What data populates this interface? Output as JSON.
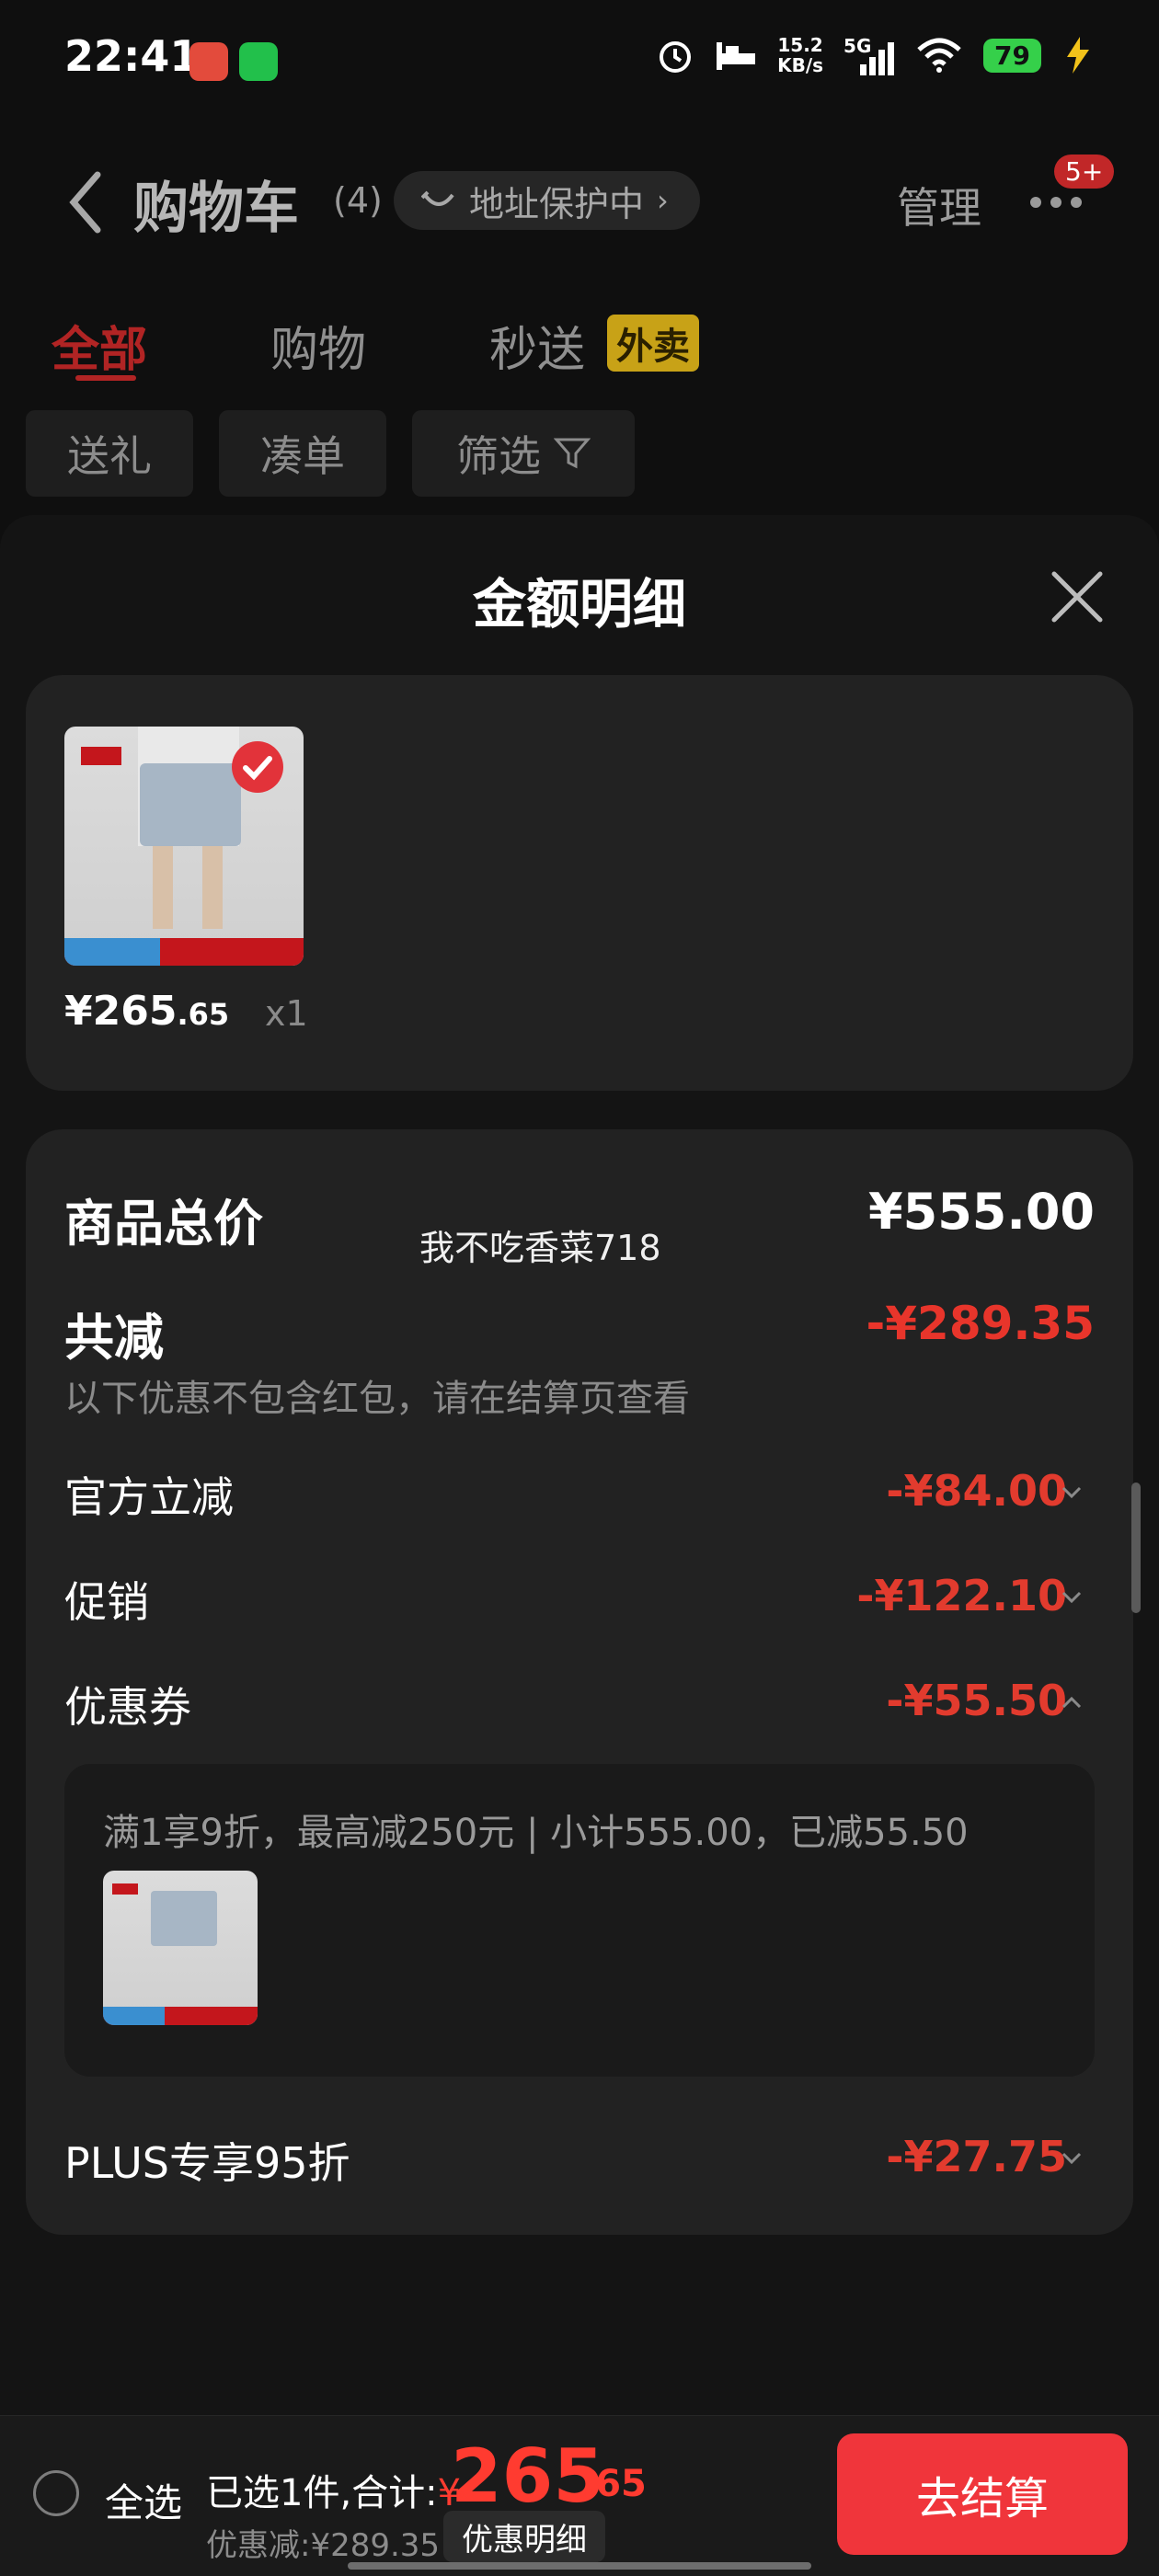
{
  "status_bar": {
    "time": "22:41",
    "net_speed_value": "15.2",
    "net_speed_unit": "KB/s",
    "network": "5G",
    "battery": "79",
    "icons": [
      "mall-app-icon",
      "wechat-icon",
      "alarm-icon",
      "sleep-icon",
      "signal-icon",
      "wifi-icon",
      "battery-icon",
      "charging-icon"
    ]
  },
  "header": {
    "title": "购物车",
    "count": "(4)",
    "address_pill": "地址保护中",
    "manage": "管理",
    "badge": "5+"
  },
  "tabs": [
    {
      "label": "全部",
      "active": true
    },
    {
      "label": "购物",
      "active": false
    },
    {
      "label": "秒送",
      "active": false,
      "tag": "外卖"
    }
  ],
  "filters": [
    "送礼",
    "凑单",
    "筛选"
  ],
  "sheet": {
    "title": "金额明细",
    "product": {
      "price_int": "¥265",
      "price_dec": ".65",
      "qty": "x1"
    },
    "summary": {
      "total_label": "商品总价",
      "total_value": "¥555.00",
      "watermark": "我不吃香菜718",
      "reduce_label": "共减",
      "reduce_value": "-¥289.35",
      "reduce_note": "以下优惠不包含红包，请在结算页查看",
      "rows": [
        {
          "label": "官方立减",
          "value": "-¥84.00",
          "expanded": false
        },
        {
          "label": "促销",
          "value": "-¥122.10",
          "expanded": false
        },
        {
          "label": "优惠券",
          "value": "-¥55.50",
          "expanded": true
        },
        {
          "label": "PLUS专享95折",
          "value": "-¥27.75",
          "expanded": false
        }
      ],
      "coupon_detail": "满1享9折，最高减250元 | 小计555.00，已减55.50"
    }
  },
  "bottom_bar": {
    "select_all": "全选",
    "selected_text": "已选1件,合计:",
    "currency": "¥",
    "price_int": "265",
    "price_dec": ".65",
    "discount": "优惠减:¥289.35",
    "detail_button": "优惠明细",
    "checkout_button": "去结算"
  },
  "colors": {
    "accent_red": "#f0353b",
    "price_red": "#e23b2e",
    "tab_active": "#b12424",
    "tag_yellow": "#c8a217",
    "battery_green": "#35d04a"
  }
}
